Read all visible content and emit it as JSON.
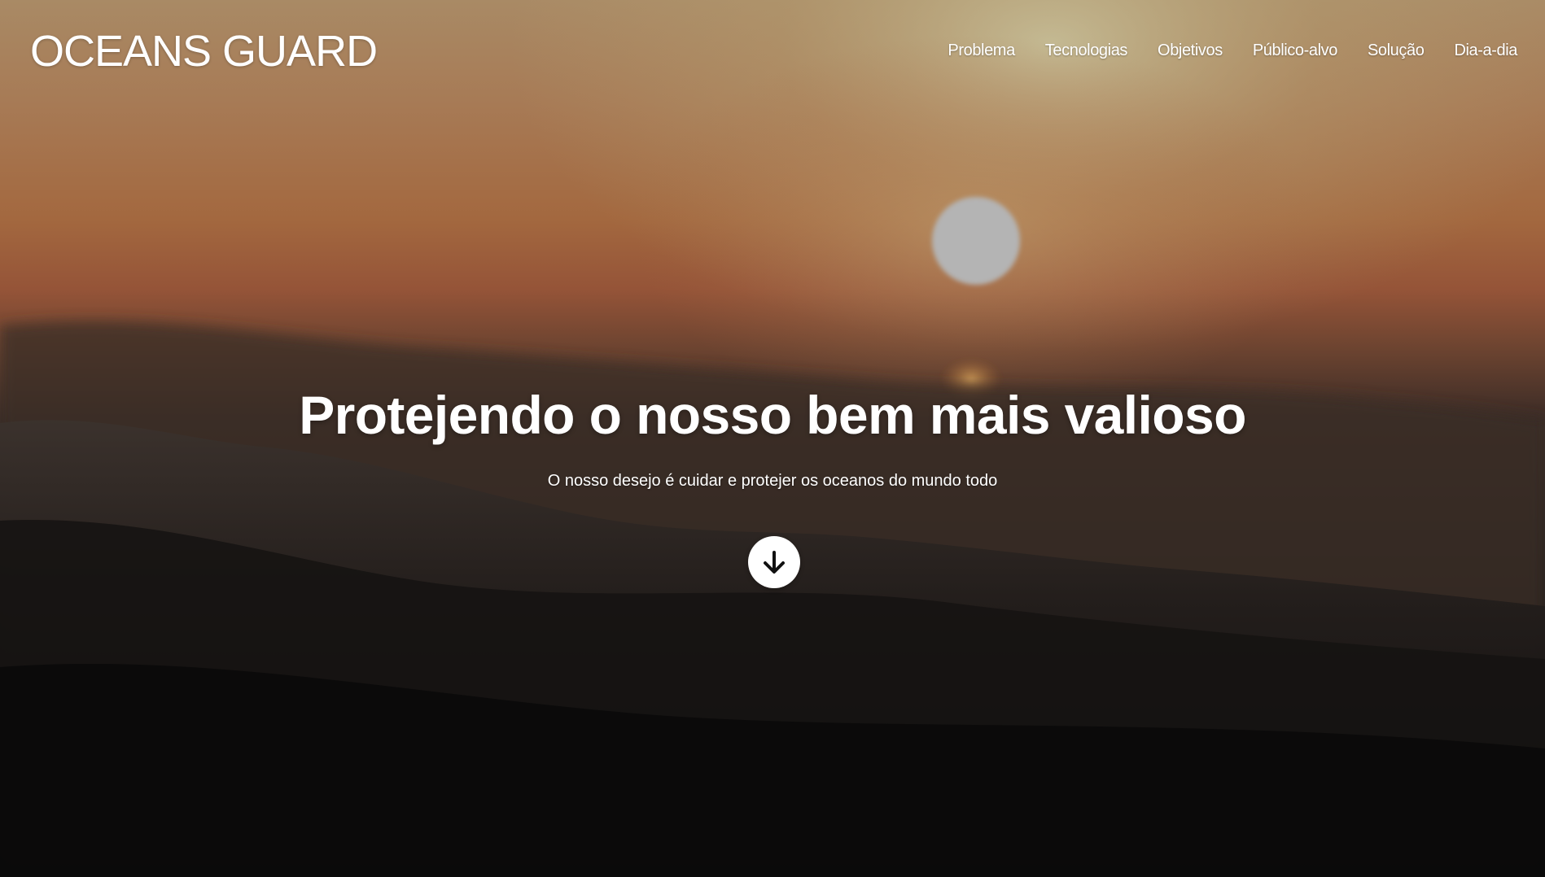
{
  "brand": {
    "title": "OCEANS GUARD"
  },
  "nav": {
    "items": [
      {
        "label": "Problema"
      },
      {
        "label": "Tecnologias"
      },
      {
        "label": "Objetivos"
      },
      {
        "label": "Público-alvo"
      },
      {
        "label": "Solução"
      },
      {
        "label": "Dia-a-dia"
      }
    ]
  },
  "hero": {
    "title": "Protejendo o nosso bem mais valioso",
    "subtitle": "O nosso desejo é cuidar e protejer os oceanos do mundo todo",
    "scroll_icon": "arrow-down-icon"
  },
  "colors": {
    "sky_top": "#a98a63",
    "sky_orange": "#a8643f",
    "sun": "#bdbdbd",
    "water_dark": "#0c0c0d",
    "text": "#ffffff"
  }
}
